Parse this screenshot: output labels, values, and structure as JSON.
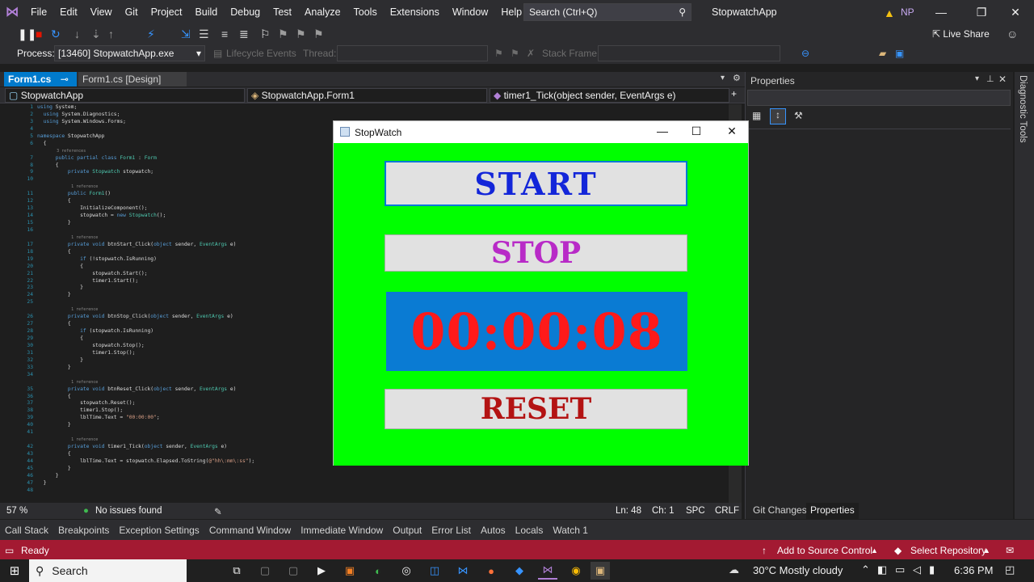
{
  "menubar": {
    "items": [
      "File",
      "Edit",
      "View",
      "Git",
      "Project",
      "Build",
      "Debug",
      "Test",
      "Analyze",
      "Tools",
      "Extensions",
      "Window",
      "Help"
    ],
    "search_placeholder": "Search (Ctrl+Q)",
    "app_title": "StopwatchApp",
    "user_initials": "NP"
  },
  "toolbar": {
    "live_share": "Live Share",
    "process_label": "Process:",
    "process_value": "[13460] StopwatchApp.exe",
    "lifecycle_label": "Lifecycle Events",
    "thread_label": "Thread:",
    "stack_frame_label": "Stack Frame:"
  },
  "tabs": {
    "active": "Form1.cs",
    "second": "Form1.cs [Design]"
  },
  "navbar": {
    "project": "StopwatchApp",
    "class": "StopwatchApp.Form1",
    "member": "timer1_Tick(object sender, EventArgs e)"
  },
  "editor": {
    "zoom": "57 %",
    "issues": "No issues found",
    "line": "Ln: 48",
    "col": "Ch: 1",
    "spc": "SPC",
    "crlf": "CRLF"
  },
  "properties": {
    "title": "Properties",
    "tab_git": "Git Changes",
    "tab_properties": "Properties"
  },
  "diagnostic_tools": "Diagnostic Tools",
  "toolwindows": [
    "Call Stack",
    "Breakpoints",
    "Exception Settings",
    "Command Window",
    "Immediate Window",
    "Output",
    "Error List",
    "Autos",
    "Locals",
    "Watch 1"
  ],
  "statusbar": {
    "state": "Ready",
    "source_control": "Add to Source Control",
    "repository": "Select Repository"
  },
  "taskbar": {
    "search": "Search",
    "weather": "30°C  Mostly cloudy",
    "time": "6:36 PM"
  },
  "stopwatch": {
    "title": "StopWatch",
    "start": "START",
    "stop": "STOP",
    "time": "00:00:08",
    "reset": "RESET"
  }
}
